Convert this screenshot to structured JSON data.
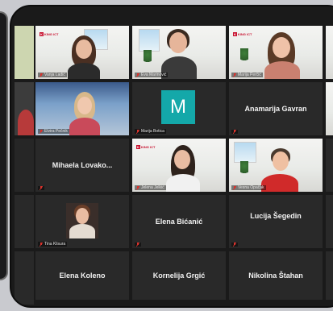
{
  "participants": [
    {
      "name": "Vanja Ladić",
      "tile": "video",
      "muted": true
    },
    {
      "name": "Eva Marinović",
      "tile": "video",
      "muted": true
    },
    {
      "name": "Marija Perčić",
      "tile": "video",
      "muted": true
    },
    {
      "name": "Elvira Pečnik",
      "tile": "video",
      "muted": true
    },
    {
      "name": "Marija Botica",
      "tile": "avatar",
      "initial": "M",
      "muted": true
    },
    {
      "name": "Anamarija Gavran",
      "tile": "name",
      "muted": true
    },
    {
      "name": "Mihaela Lovako...",
      "tile": "name",
      "muted": true
    },
    {
      "name": "Jelena Jelkić",
      "tile": "video",
      "muted": true
    },
    {
      "name": "Vesna Opačak",
      "tile": "video",
      "muted": true
    },
    {
      "name": "Tina Klisura",
      "tile": "video",
      "muted": true
    },
    {
      "name": "Elena Bićanić",
      "tile": "name",
      "muted": true
    },
    {
      "name": "Lucija Šegedin",
      "tile": "name",
      "muted": true
    },
    {
      "name": "Elena Koleno",
      "tile": "name",
      "muted": false
    },
    {
      "name": "Kornelija Grgić",
      "tile": "name",
      "muted": false
    },
    {
      "name": "Nikolina Štahan",
      "tile": "name",
      "muted": false
    }
  ],
  "brand": {
    "logo_text": "KING ICT"
  },
  "colors": {
    "avatar_teal": "#14a8a9",
    "tile_bg": "#292929",
    "mute_red": "#d9322c"
  }
}
